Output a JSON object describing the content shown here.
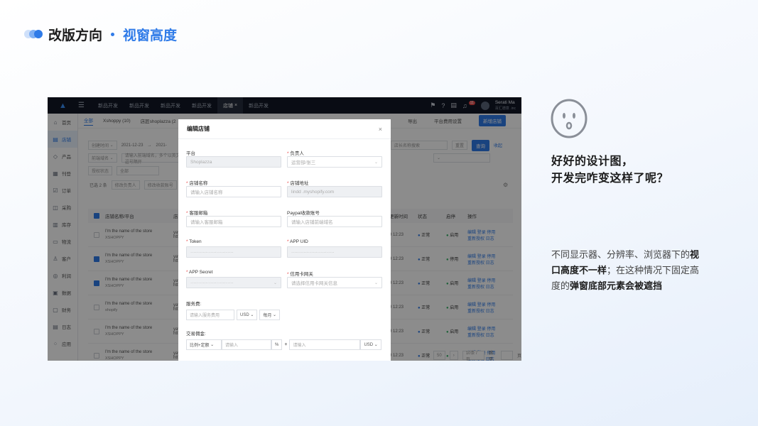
{
  "header": {
    "title": "改版方向",
    "subtitle": "视窗高度"
  },
  "screenshot": {
    "topbar": {
      "tabs": [
        "新品开发",
        "新品开发",
        "新品开发",
        "新品开发",
        "店铺",
        "新品开发"
      ],
      "active_tab": "店铺",
      "close_glyph": "×",
      "badge": "11",
      "user_name": "Serati Ma",
      "company": "百汇德意 .inc"
    },
    "sidebar": {
      "items": [
        {
          "label": "首页",
          "icon": "home-icon",
          "glyph": "⌂"
        },
        {
          "label": "店铺",
          "icon": "store-icon",
          "glyph": "▤"
        },
        {
          "label": "产品",
          "icon": "tag-icon",
          "glyph": "◇"
        },
        {
          "label": "刊登",
          "icon": "grid-icon",
          "glyph": "▦"
        },
        {
          "label": "订单",
          "icon": "order-icon",
          "glyph": "☑"
        },
        {
          "label": "采购",
          "icon": "cart-icon",
          "glyph": "◫"
        },
        {
          "label": "库存",
          "icon": "warehouse-icon",
          "glyph": "▥"
        },
        {
          "label": "物流",
          "icon": "truck-icon",
          "glyph": "▭"
        },
        {
          "label": "客户",
          "icon": "user-icon",
          "glyph": "♙"
        },
        {
          "label": "利润",
          "icon": "coin-icon",
          "glyph": "◎"
        },
        {
          "label": "数据",
          "icon": "chart-icon",
          "glyph": "▣"
        },
        {
          "label": "财务",
          "icon": "wallet-icon",
          "glyph": "▢"
        },
        {
          "label": "日志",
          "icon": "log-icon",
          "glyph": "▤"
        },
        {
          "label": "应用",
          "icon": "apps-icon",
          "glyph": "⁘"
        }
      ],
      "active_index": 1
    },
    "subtabs": [
      "全部",
      "Xshoppy (10)",
      "店匠shoplazza (2"
    ],
    "actions": {
      "export": "导出",
      "fee_setting": "平台费用设置",
      "new_store": "新增店铺"
    },
    "filters": {
      "created_time": "创建时间",
      "date_from": "2021-12-23",
      "date_to": "2021-",
      "frontend_name": "前端域名",
      "name_placeholder": "请输入前端域名，多个以英文逗号隔开",
      "auth_status": "授权状态",
      "auth_value": "全部",
      "search_placeholder": "店长名称搜索",
      "reset": "重置",
      "search": "查询",
      "collapse": "收起"
    },
    "bulk": {
      "selected": "已选 2 条",
      "set_owner": "修改负责人",
      "set_account": "修改收款账号"
    },
    "table": {
      "columns": [
        "店铺名称/平台",
        "店铺",
        "更新时间",
        "状态",
        "启停",
        "操作"
      ],
      "rows": [
        {
          "name": "I'm the name of the store",
          "platform": "XSHOPPY",
          "domain": "yayu",
          "url": "http",
          "time": "9 12:23",
          "status": "正常",
          "toggle": "启用",
          "checked": false
        },
        {
          "name": "I'm the name of the store",
          "platform": "XSHOPPY",
          "domain": "yayu",
          "url": "http",
          "time": "9 12:23",
          "status": "正常",
          "toggle": "停用",
          "checked": true
        },
        {
          "name": "I'm the name of the store",
          "platform": "XSHOPPY",
          "domain": "yayu",
          "url": "http",
          "time": "9 12:23",
          "status": "正常",
          "toggle": "启用",
          "checked": true
        },
        {
          "name": "I'm the name of the store",
          "platform": "shopify",
          "domain": "yayu",
          "url": "http",
          "time": "9 12:23",
          "status": "正常",
          "toggle": "启用",
          "checked": false
        },
        {
          "name": "I'm the name of the store",
          "platform": "XSHOPPY",
          "domain": "yayu",
          "url": "http",
          "time": "9 12:23",
          "status": "正常",
          "toggle": "启用",
          "checked": false
        },
        {
          "name": "I'm the name of the store",
          "platform": "XSHOPPY",
          "domain": "yayu",
          "url": "http",
          "time": "9 12:23",
          "status": "正常",
          "toggle": "启用",
          "checked": false
        }
      ],
      "ops_line1": "编辑  登录  停用",
      "ops_line2": "重新授权  日志"
    },
    "pagination": {
      "ellipsis": "···",
      "last": "50",
      "next": "›",
      "size": "10条 / 页",
      "jump": "跳至",
      "page": "页"
    },
    "modal": {
      "title": "编辑店铺",
      "close": "×",
      "fields": {
        "platform": {
          "label": "平台",
          "value": "Shoplazza"
        },
        "owner": {
          "label": "负责人",
          "placeholder": "运营部/张三"
        },
        "store_name": {
          "label": "店铺名称",
          "placeholder": "请输入店铺名称"
        },
        "store_url": {
          "label": "店铺地址",
          "value": "lindd .myshopify.com"
        },
        "email": {
          "label": "客服邮箱",
          "placeholder": "请输入客服邮箱"
        },
        "paypal": {
          "label": "Paypal收款账号",
          "placeholder": "请输入店铺前端域名"
        },
        "token": {
          "label": "Token",
          "value": "····························"
        },
        "app_uid": {
          "label": "APP UID",
          "value": "····························"
        },
        "app_secret": {
          "label": "APP Secret",
          "value": "····························"
        },
        "gateway": {
          "label": "信用卡网关",
          "placeholder": "请选择信用卡网关信息"
        }
      },
      "service_fee": {
        "label": "服务费:",
        "placeholder": "请输入服务费用",
        "currency": "USD",
        "period": "每月"
      },
      "commission": {
        "label": "交易佣金:",
        "type": "比例+定额",
        "rate_placeholder": "请输入",
        "percent": "%",
        "plus": "+",
        "amount_placeholder": "请输入",
        "currency": "USD"
      }
    }
  },
  "right": {
    "question_line1": "好好的设计图，",
    "question_line2": "开发完咋变这样了呢？",
    "desc_a": "不同显示器、分辨率、浏览器下的",
    "desc_b": "视口高度不一样",
    "desc_c": "；在这种情况下固定高度的",
    "desc_d": "弹窗底部元素会被遮挡"
  }
}
